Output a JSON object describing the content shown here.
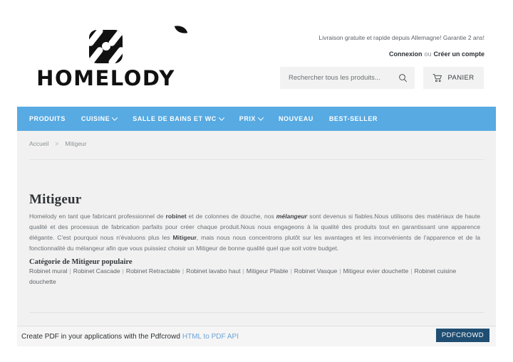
{
  "header": {
    "logo_text": "HOMELODY",
    "shipping_note": "Livraison gratuite et rapide depuis Allemagne! Garantie 2 ans!",
    "login_label": "Connexion",
    "or_label": "ou",
    "create_account_label": "Créer un compte",
    "search": {
      "placeholder": "Rechercher tous les produits...",
      "value": ""
    },
    "cart_label": "PANIER"
  },
  "nav": {
    "items": [
      {
        "label": "PRODUITS",
        "has_dropdown": false
      },
      {
        "label": "CUISINE",
        "has_dropdown": true
      },
      {
        "label": "SALLE DE BAINS ET WC",
        "has_dropdown": true
      },
      {
        "label": "PRIX",
        "has_dropdown": true
      },
      {
        "label": "NOUVEAU",
        "has_dropdown": false
      },
      {
        "label": "BEST-SELLER",
        "has_dropdown": false
      }
    ]
  },
  "breadcrumb": {
    "home": "Accueil",
    "arrow": ">",
    "current": "Mitigeur"
  },
  "main": {
    "title": "Mitigeur",
    "paragraph_part1": "Homelody en tant que fabricant professionnel de ",
    "bold1": "robinet",
    "paragraph_part2": " et de colonnes de douche, nos ",
    "bold2": "mélangeur",
    "paragraph_part3": " sont devenus si fiables.Nous utilisons des matériaux de haute qualité et des processus de fabrication parfaits pour créer chaque produit.Nous nous engageons à la qualité des produits tout en garantissant une apparence élégante. C'est pourquoi nous n'évaluons plus les ",
    "bold3": "Mitigeur",
    "paragraph_part4": ", mais nous nous concentrons plutôt sur les avantages et les inconvénients de l'apparence et de la fonctionnalité du mélangeur afin que vous puissiez choisir un Mitigeur de bonne qualité quel que soit votre budget.",
    "subheading": "Catégorie de Mitigeur populaire",
    "category_links": [
      "Robinet mural",
      "Robinet Cascade",
      "Robinet Retractable",
      "Robinet lavabo haut",
      "Mitigeur Pliable",
      "Robinet Vasque",
      "Mitigeur evier douchette",
      "Robinet cuisine douchette"
    ]
  },
  "footer": {
    "text": "Create PDF in your applications with the Pdfcrowd",
    "link_label": "HTML to PDF API",
    "badge_label": "PDFCROWD"
  },
  "colors": {
    "nav_blue": "#57aae2",
    "content_gray": "#f1f1f1",
    "badge_navy": "#1f4e72",
    "link_blue": "#6ba3d6"
  }
}
